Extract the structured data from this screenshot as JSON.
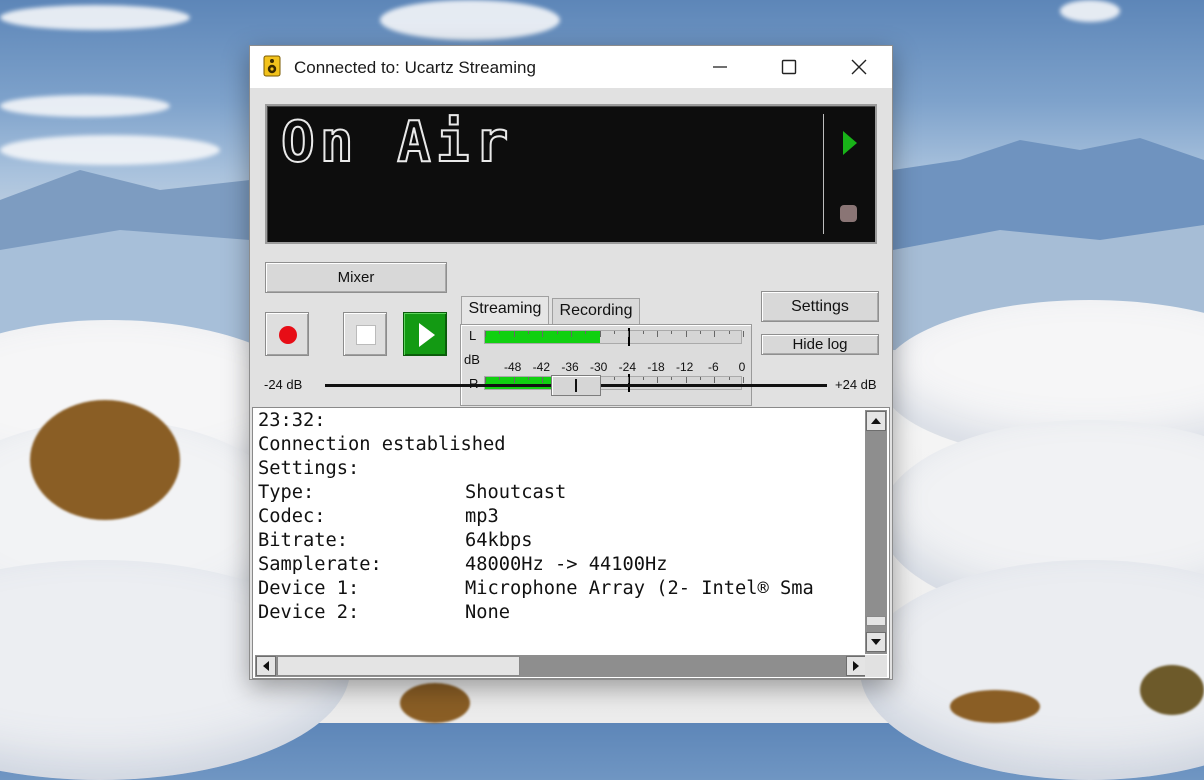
{
  "window": {
    "title": "Connected to: Ucartz Streaming"
  },
  "display": {
    "status_text": "On Air"
  },
  "controls": {
    "mixer_label": "Mixer",
    "settings_label": "Settings",
    "hide_log_label": "Hide log",
    "tabs": [
      {
        "label": "Streaming",
        "active": true
      },
      {
        "label": "Recording",
        "active": false
      }
    ]
  },
  "meter": {
    "left_label": "L",
    "right_label": "R",
    "unit_label": "dB",
    "scale": [
      "-48",
      "-42",
      "-36",
      "-30",
      "-24",
      "-18",
      "-12",
      "-6",
      "0"
    ],
    "left_level_db": -30,
    "right_level_db": -30,
    "left_peak_db": -24,
    "right_peak_db": -24
  },
  "gain": {
    "min_label": "-24 dB",
    "max_label": "+24 dB",
    "value_db": 0
  },
  "log": {
    "lines": [
      {
        "key": "23:32:",
        "value": ""
      },
      {
        "key": "Connection established",
        "value": ""
      },
      {
        "key": "Settings:",
        "value": ""
      },
      {
        "key": "Type:",
        "value": "Shoutcast"
      },
      {
        "key": "Codec:",
        "value": "mp3"
      },
      {
        "key": "Bitrate:",
        "value": "64kbps"
      },
      {
        "key": "Samplerate:",
        "value": "48000Hz -> 44100Hz"
      },
      {
        "key": "Device 1:",
        "value": "Microphone Array (2- Intel® Sma"
      },
      {
        "key": "Device 2:",
        "value": "None"
      }
    ]
  },
  "colors": {
    "onair_green": "#139a13",
    "record_red": "#e70d16",
    "meter_green": "#10d010"
  }
}
